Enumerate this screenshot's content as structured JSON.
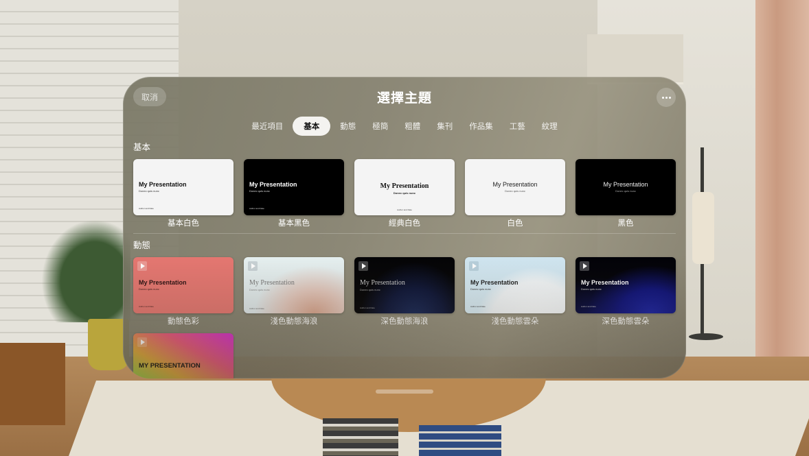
{
  "window": {
    "title": "選擇主題",
    "cancel_label": "取消",
    "more_icon": "ellipsis-icon"
  },
  "tabs": [
    {
      "label": "最近項目",
      "active": false
    },
    {
      "label": "基本",
      "active": true
    },
    {
      "label": "動態",
      "active": false
    },
    {
      "label": "極簡",
      "active": false
    },
    {
      "label": "粗體",
      "active": false
    },
    {
      "label": "集刊",
      "active": false
    },
    {
      "label": "作品集",
      "active": false
    },
    {
      "label": "工藝",
      "active": false
    },
    {
      "label": "紋理",
      "active": false
    }
  ],
  "sections": [
    {
      "title": "基本",
      "themes": [
        {
          "label": "基本白色",
          "slide_title": "My Presentation",
          "slide_subtitle": "Donec quis nunc",
          "slide_author": "Author and Date"
        },
        {
          "label": "基本黑色",
          "slide_title": "My Presentation",
          "slide_subtitle": "Donec quis nunc",
          "slide_author": "Author and Date"
        },
        {
          "label": "經典白色",
          "slide_title": "My Presentation",
          "slide_subtitle": "Donec quis nunc",
          "slide_author": "Author and Date"
        },
        {
          "label": "白色",
          "slide_title": "My Presentation",
          "slide_subtitle": "Donec quis nunc"
        },
        {
          "label": "黑色",
          "slide_title": "My Presentation",
          "slide_subtitle": "Donec quis nunc"
        }
      ]
    },
    {
      "title": "動態",
      "themes": [
        {
          "label": "動態色彩",
          "slide_title": "My Presentation",
          "slide_subtitle": "Donec quis nunc",
          "slide_author": "Author and Date",
          "icon": "play-icon"
        },
        {
          "label": "淺色動態海浪",
          "slide_title": "My Presentation",
          "slide_subtitle": "Donec quis nunc",
          "slide_author": "Author and Date",
          "icon": "play-icon"
        },
        {
          "label": "深色動態海浪",
          "slide_title": "My Presentation",
          "slide_subtitle": "Donec quis nunc",
          "slide_author": "Author and Date",
          "icon": "play-icon"
        },
        {
          "label": "淺色動態雲朵",
          "slide_title": "My Presentation",
          "slide_subtitle": "Donec quis nunc",
          "slide_author": "Author and Date",
          "icon": "play-icon"
        },
        {
          "label": "深色動態雲朵",
          "slide_title": "My Presentation",
          "slide_subtitle": "Donec quis nunc",
          "slide_author": "Author and Date",
          "icon": "play-icon"
        },
        {
          "label": "",
          "slide_title": "MY PRESENTATION",
          "icon": "play-icon"
        }
      ]
    }
  ],
  "colors": {
    "active_tab_bg": "#f4f3f0",
    "dynamic_color_bg": "#e57771",
    "dark_clouds_accent": "#1a1f8a"
  }
}
